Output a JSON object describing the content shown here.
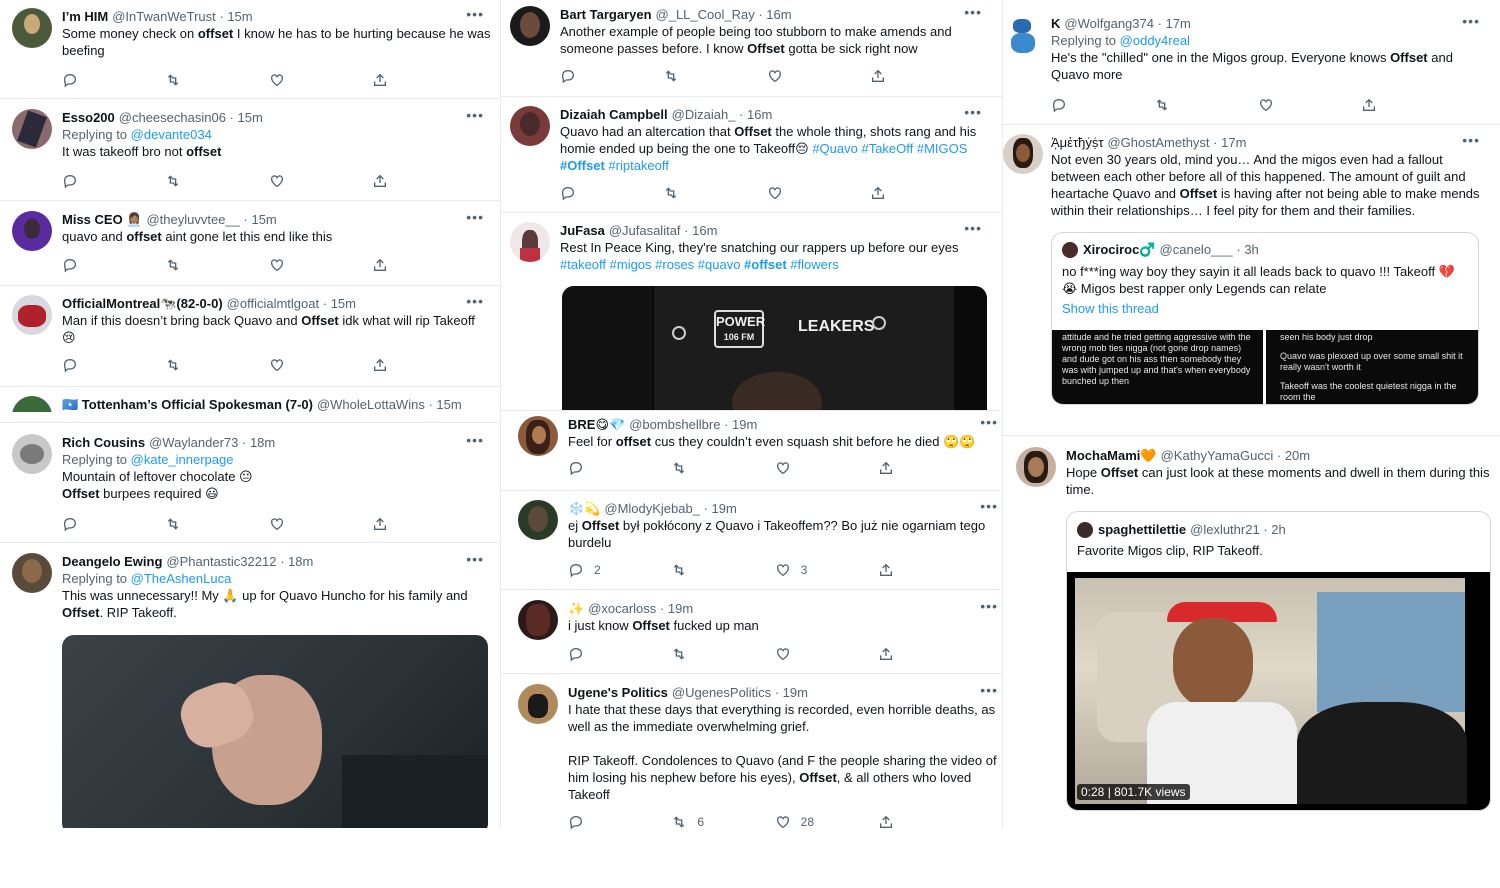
{
  "col1": {
    "t1": {
      "name": "I’m HIM",
      "handle": "@InTwanWeTrust",
      "time": "· 15m",
      "text_pre": "Some money check on ",
      "text_bold": "offset",
      "text_post": " I know he has to be hurting because he was beefing"
    },
    "t2": {
      "name": "Esso200",
      "handle": "@cheesechasin06",
      "time": "· 15m",
      "reply_pre": "Replying to ",
      "reply_to": "@devante034",
      "text_pre": "It was takeoff bro not ",
      "text_bold": "offset"
    },
    "t3": {
      "name": "Miss CEO 👩🏽‍💼",
      "handle": "@theyluvvtee__",
      "time": "· 15m",
      "text_pre": "quavo and ",
      "text_bold": "offset",
      "text_post": " aint gone let this end like this"
    },
    "t4": {
      "name": "OfficialMontreal🐄(82-0-0)",
      "handle": "@officialmtlgoat",
      "time": "· 15m",
      "text_pre": "Man if this doesn’t bring back Quavo and ",
      "text_bold": "Offset",
      "text_post": " idk what will rip Takeoff",
      "emoji": "😢"
    },
    "t5": {
      "name": "🇸🇴 Tottenham’s Official Spokesman (7-0)",
      "handle": "@WholeLottaWins",
      "time": "· 15m"
    },
    "t6": {
      "name": "Rich Cousins",
      "handle": "@Waylander73",
      "time": "· 18m",
      "reply_pre": "Replying to ",
      "reply_to": "@kate_innerpage",
      "line1": "Mountain of leftover chocolate 😐",
      "line2_bold": "Offset",
      "line2_post": " burpees required 😃"
    },
    "t7": {
      "name": "Deangelo Ewing",
      "handle": "@Phantastic32212",
      "time": "· 18m",
      "reply_pre": "Replying to ",
      "reply_to": "@TheAshenLuca",
      "text_pre": "This was unnecessary!! My 🙏 up for Quavo Huncho for his family and ",
      "text_bold": "Offset",
      "text_post": ". RIP Takeoff."
    }
  },
  "col2": {
    "t1": {
      "name": "Bart Targaryen",
      "handle": "@_LL_Cool_Ray",
      "time": "· 16m",
      "text_pre": "Another example of people being too stubborn to make amends and someone passes before. I know ",
      "text_bold": "Offset",
      "text_post": " gotta be sick right now"
    },
    "t2": {
      "name": "Dizaiah Campbell",
      "handle": "@Dizaiah_",
      "time": "· 16m",
      "text_pre": "Quavo had an altercation that ",
      "text_bold": "Offset",
      "text_post": " the whole thing, shots rang and his homie ended up being the one to Takeoff😔 ",
      "tags1": "#Quavo #TakeOff #MIGOS",
      "tags2_bold": "#Offset",
      "tags2": " #riptakeoff"
    },
    "t3": {
      "name": "JuFasa",
      "handle": "@Jufasalitaf",
      "time": "· 16m",
      "text": "Rest In Peace King, they're snatching our rappers up before our eyes",
      "tags_pre": "#takeoff #migos #roses #quavo ",
      "tags_bold": "#offset",
      "tags_post": " #flowers",
      "logo1": "POWER",
      "logo1b": "106 FM",
      "logo2": "LEAKERS"
    },
    "t4": {
      "name": "BRE😋💎",
      "handle": "@bombshellbre",
      "time": "· 19m",
      "text_pre": "Feel for ",
      "text_bold": "offset",
      "text_post": " cus they couldn’t even squash shit before he died 🙄🙄"
    },
    "t5": {
      "name": "❄️💫",
      "handle": "@MlodyKjebab_",
      "time": "· 19m",
      "text_pre": "ej ",
      "text_bold": "Offset",
      "text_post": " był pokłócony z Quavo i Takeoffem?? Bo już nie ogarniam tego burdelu",
      "replies": "2",
      "likes": "3"
    },
    "t6": {
      "name": "✨",
      "handle": "@xocarloss",
      "time": "· 19m",
      "text_pre": "i just know ",
      "text_bold": "Offset",
      "text_post": " fucked up man"
    },
    "t7": {
      "name": "Ugene's Politics",
      "handle": "@UgenesPolitics",
      "time": "· 19m",
      "p1": "I hate that these days that everything is recorded, even horrible deaths, as well as the immediate overwhelming grief.",
      "p2_pre": "RIP Takeoff. Condolences to Quavo (and F the people sharing the video of him losing his nephew before his eyes), ",
      "p2_bold": "Offset",
      "p2_post": ", & all others who loved Takeoff",
      "retweets": "6",
      "likes": "28"
    }
  },
  "col3": {
    "t1": {
      "name": "K",
      "handle": "@Wolfgang374",
      "time": "· 17m",
      "reply_pre": "Replying to ",
      "reply_to": "@oddy4real",
      "text_pre": "He's the \"chilled\" one in the Migos group. Everyone knows ",
      "text_bold": "Offset",
      "text_post": " and Quavo more"
    },
    "t2": {
      "name": "ᾈμἐτђẏṩτ",
      "handle": "@GhostAmethyst",
      "time": "· 17m",
      "text_pre": "Not even 30 years old, mind you… And the migos even had a fallout between each other before all of this happened. The amount of guilt and heartache Quavo and ",
      "text_bold": "Offset",
      "text_post": " is having after not being able to make mends within their relationships… I feel pity for them and their families.",
      "quote": {
        "name": "Xirociroc♂️",
        "handle": "@canelo___",
        "time": "· 3h",
        "line1": "no f***ing way boy  they sayin it all leads back to quavo !!! Takeoff 💔",
        "line2": "😭 Migos best rapper only Legends can relate",
        "show_thread": "Show this thread",
        "shot_left": "attitude and he tried getting aggressive with the wrong mob ties nigga (not gone drop names) and dude got on his ass then somebody they was with jumped up and that's when everybody bunched up then",
        "shot_right_1": "seen his body just drop",
        "shot_right_2": "Quavo was plexxed up over some small shit it really wasn't worth it",
        "shot_right_3": "Takeoff was the coolest quietest nigga in the room the"
      }
    },
    "t3": {
      "name": "MochaMami🧡",
      "handle": "@KathyYamaGucci",
      "time": "· 20m",
      "text_pre": "Hope ",
      "text_bold": "Offset",
      "text_post": " can just look at these moments and dwell in them during this time.",
      "quote": {
        "name": "spaghettilettie",
        "handle": "@lexluthr21",
        "time": "· 2h",
        "text": "Favorite Migos clip, RIP Takeoff.",
        "duration": "0:28",
        "views": "801.7K views"
      }
    }
  },
  "colors": {
    "accent": "#1d9bf0",
    "secondary": "#536471",
    "border": "#cfd9de",
    "text": "#0f1419"
  },
  "icons": [
    "reply-icon",
    "retweet-icon",
    "like-icon",
    "share-icon",
    "more-icon"
  ]
}
